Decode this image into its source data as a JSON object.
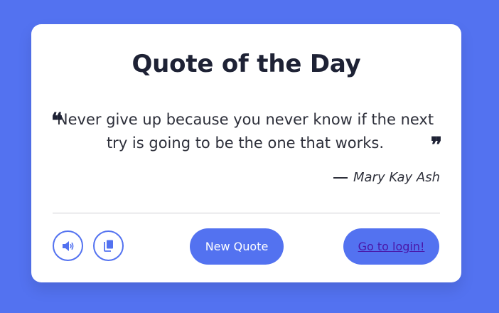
{
  "header": {
    "title": "Quote of the Day"
  },
  "quote": {
    "text": "Never give up because you never know if the next try is going to be the one that works.",
    "open_mark": "❝",
    "close_mark": "❞",
    "author": "Mary Kay Ash"
  },
  "actions": {
    "speech_icon": "speaker-icon",
    "copy_icon": "copy-icon",
    "new_quote_label": "New Quote",
    "login_label": "Go to login!"
  },
  "colors": {
    "background": "#5372f0",
    "accent": "#5372f0",
    "card": "#ffffff",
    "title": "#1e2235",
    "link": "#4a16a8"
  }
}
